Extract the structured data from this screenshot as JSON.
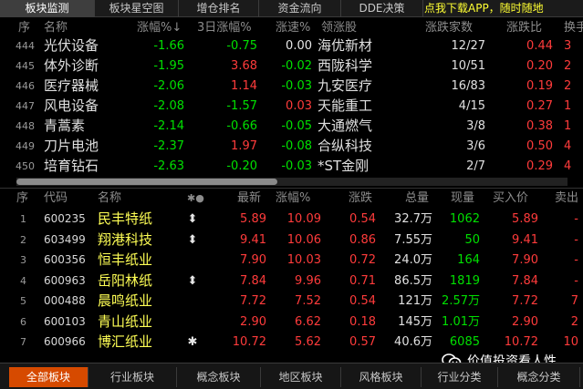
{
  "top_tabs": [
    {
      "label": "板块监测",
      "active": true
    },
    {
      "label": "板块星空图"
    },
    {
      "label": "增仓排名"
    },
    {
      "label": "资金流向"
    },
    {
      "label": "DDE决策"
    }
  ],
  "promo": "点我下载APP，随时随地",
  "sector_headers": {
    "seq": "序",
    "name": "名称",
    "change": "涨幅%↓",
    "change3d": "3日涨幅%",
    "speed": "涨速%",
    "leader": "领涨股",
    "updown": "涨跌家数",
    "ratio": "涨跌比",
    "turnover": "换手"
  },
  "sectors": [
    {
      "seq": "444",
      "name": "光伏设备",
      "change": "-1.66",
      "change3d": "-0.75",
      "speed": "0.00",
      "leader": "海优新材",
      "updown": "12/27",
      "ratio": "0.44",
      "turnover": "3"
    },
    {
      "seq": "445",
      "name": "体外诊断",
      "change": "-1.95",
      "change3d": "3.68",
      "speed": "-0.02",
      "leader": "西陇科学",
      "updown": "10/51",
      "ratio": "0.20",
      "turnover": "2"
    },
    {
      "seq": "446",
      "name": "医疗器械",
      "change": "-2.06",
      "change3d": "1.14",
      "speed": "-0.03",
      "leader": "九安医疗",
      "updown": "16/83",
      "ratio": "0.19",
      "turnover": "2"
    },
    {
      "seq": "447",
      "name": "风电设备",
      "change": "-2.08",
      "change3d": "-1.57",
      "speed": "0.03",
      "leader": "天能重工",
      "updown": "4/15",
      "ratio": "0.27",
      "turnover": "1"
    },
    {
      "seq": "448",
      "name": "青蒿素",
      "change": "-2.14",
      "change3d": "-0.66",
      "speed": "-0.05",
      "leader": "大通燃气",
      "updown": "3/8",
      "ratio": "0.38",
      "turnover": "1"
    },
    {
      "seq": "449",
      "name": "刀片电池",
      "change": "-2.37",
      "change3d": "1.97",
      "speed": "-0.08",
      "leader": "合纵科技",
      "updown": "3/6",
      "ratio": "0.50",
      "turnover": "4"
    },
    {
      "seq": "450",
      "name": "培育钻石",
      "change": "-2.63",
      "change3d": "-0.20",
      "speed": "-0.03",
      "leader": "*ST金刚",
      "updown": "2/7",
      "ratio": "0.29",
      "turnover": "4"
    }
  ],
  "stock_headers": {
    "seq": "序",
    "code": "代码",
    "name": "名称",
    "flag": "✱●",
    "last": "最新",
    "change": "涨幅%",
    "updown": "涨跌",
    "volume": "总量",
    "current": "现量",
    "bid": "买入价",
    "ask": "卖出"
  },
  "stocks": [
    {
      "seq": "1",
      "code": "600235",
      "name": "民丰特纸",
      "flag": "⬍",
      "last": "5.89",
      "change": "10.09",
      "updown": "0.54",
      "volume": "32.7万",
      "current": "1062",
      "bid": "5.89",
      "ask": "-"
    },
    {
      "seq": "2",
      "code": "603499",
      "name": "翔港科技",
      "flag": "⬍",
      "last": "9.41",
      "change": "10.06",
      "updown": "0.86",
      "volume": "7.55万",
      "current": "50",
      "bid": "9.41",
      "ask": "-"
    },
    {
      "seq": "3",
      "code": "600356",
      "name": "恒丰纸业",
      "flag": "",
      "last": "7.90",
      "change": "10.03",
      "updown": "0.72",
      "volume": "24.0万",
      "current": "164",
      "bid": "7.90",
      "ask": "-"
    },
    {
      "seq": "4",
      "code": "600963",
      "name": "岳阳林纸",
      "flag": "⬍",
      "last": "7.84",
      "change": "9.96",
      "updown": "0.71",
      "volume": "86.5万",
      "current": "1819",
      "bid": "7.84",
      "ask": "-"
    },
    {
      "seq": "5",
      "code": "000488",
      "name": "晨鸣纸业",
      "flag": "",
      "last": "7.72",
      "change": "7.52",
      "updown": "0.54",
      "volume": "121万",
      "current": "2.57万",
      "bid": "7.72",
      "ask": "7"
    },
    {
      "seq": "6",
      "code": "600103",
      "name": "青山纸业",
      "flag": "",
      "last": "2.90",
      "change": "6.62",
      "updown": "0.18",
      "volume": "145万",
      "current": "1.01万",
      "bid": "2.90",
      "ask": "2"
    },
    {
      "seq": "7",
      "code": "600966",
      "name": "博汇纸业",
      "flag": "✱",
      "last": "10.72",
      "change": "5.62",
      "updown": "0.57",
      "volume": "40.6万",
      "current": "6085",
      "bid": "10.72",
      "ask": "10"
    }
  ],
  "bottom_tabs": [
    {
      "label": "全部板块",
      "active": true
    },
    {
      "label": "行业板块"
    },
    {
      "label": "概念板块"
    },
    {
      "label": "地区板块"
    },
    {
      "label": "风格板块"
    },
    {
      "label": "行业分类"
    },
    {
      "label": "概念分类"
    }
  ],
  "watermark": "价值投资看人性",
  "colors": {
    "rise": "#ff3b3b",
    "fall": "#00e000",
    "stock_name": "#ffff55",
    "active_tab": "#d64a00"
  }
}
